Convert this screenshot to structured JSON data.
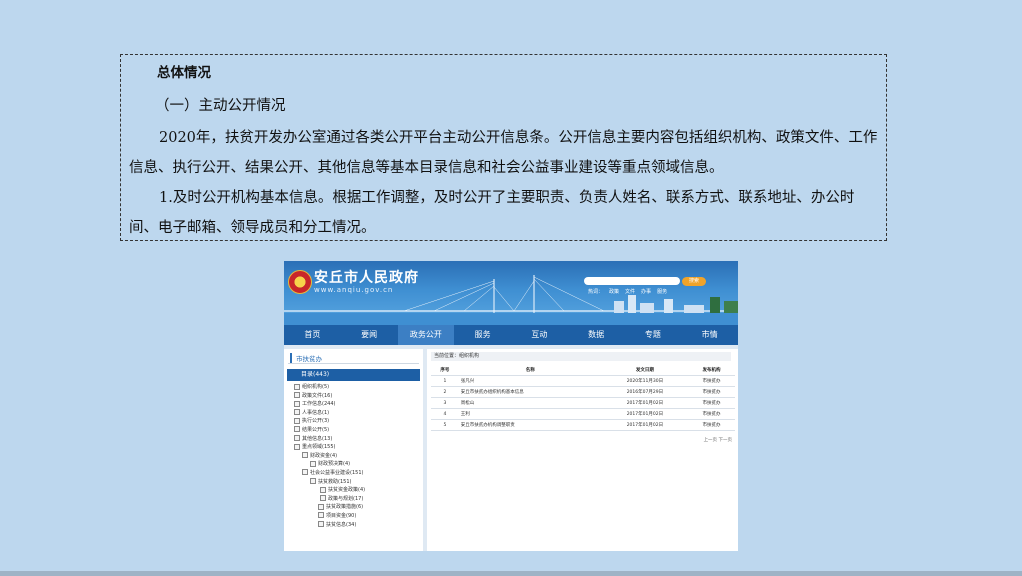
{
  "report": {
    "heading": "总体情况",
    "subheading": "（一）主动公开情况",
    "para1": "2020年，扶贫开发办公室通过各类公开平台主动公开信息条。公开信息主要内容包括组织机构、政策文件、工作信息、执行公开、结果公开、其他信息等基本目录信息和社会公益事业建设等重点领域信息。",
    "para2": "1.及时公开机构基本信息。根据工作调整，及时公开了主要职责、负责人姓名、联系方式、联系地址、办公时间、电子邮箱、领导成员和分工情况。"
  },
  "site": {
    "title": "安丘市人民政府",
    "url": "www.anqiu.gov.cn",
    "search_button": "搜索",
    "hot": [
      "热词：",
      "政策",
      "文件",
      "办事",
      "服务"
    ],
    "nav": [
      "首页",
      "要闻",
      "政务公开",
      "服务",
      "互动",
      "数据",
      "专题",
      "市情"
    ],
    "left_head": "市扶贫办",
    "directory": "目录(443)",
    "tree": [
      {
        "level": 1,
        "label": "组织机构(5)"
      },
      {
        "level": 1,
        "label": "政策文件(16)"
      },
      {
        "level": 1,
        "label": "工作信息(244)"
      },
      {
        "level": 1,
        "label": "人事信息(1)"
      },
      {
        "level": 1,
        "label": "执行公开(3)"
      },
      {
        "level": 1,
        "label": "结果公开(5)"
      },
      {
        "level": 1,
        "label": "其他信息(13)"
      },
      {
        "level": 1,
        "label": "重点领域(155)"
      },
      {
        "level": 2,
        "label": "财政资金(4)"
      },
      {
        "level": 3,
        "label": "财政预决算(4)"
      },
      {
        "level": 2,
        "label": "社会公益事业建设(151)"
      },
      {
        "level": 3,
        "label": "扶贫救助(151)"
      },
      {
        "level": 4,
        "label": "扶贫资金政策(4)"
      },
      {
        "level": 4,
        "label": "政策与规划(17)"
      },
      {
        "level": 5,
        "label": "扶贫政策措施(6)"
      },
      {
        "level": 5,
        "label": "项目资金(90)"
      },
      {
        "level": 5,
        "label": "扶贫信息(34)"
      }
    ],
    "breadcrumb": "当前位置：组织机构",
    "table": {
      "headers": [
        "序号",
        "名称",
        "发文日期",
        "发布机构"
      ],
      "rows": [
        [
          "1",
          "张凡兴",
          "2020年11月30日",
          "市扶贫办"
        ],
        [
          "2",
          "安丘市扶贫办组织机构基本信息",
          "2016年07月29日",
          "市扶贫办"
        ],
        [
          "3",
          "周松山",
          "2017年01月02日",
          "市扶贫办"
        ],
        [
          "4",
          "王利",
          "2017年01月02日",
          "市扶贫办"
        ],
        [
          "5",
          "安丘市扶贫办机构调整职责",
          "2017年01月02日",
          "市扶贫办"
        ]
      ]
    },
    "pager": "上一页 下一页"
  }
}
